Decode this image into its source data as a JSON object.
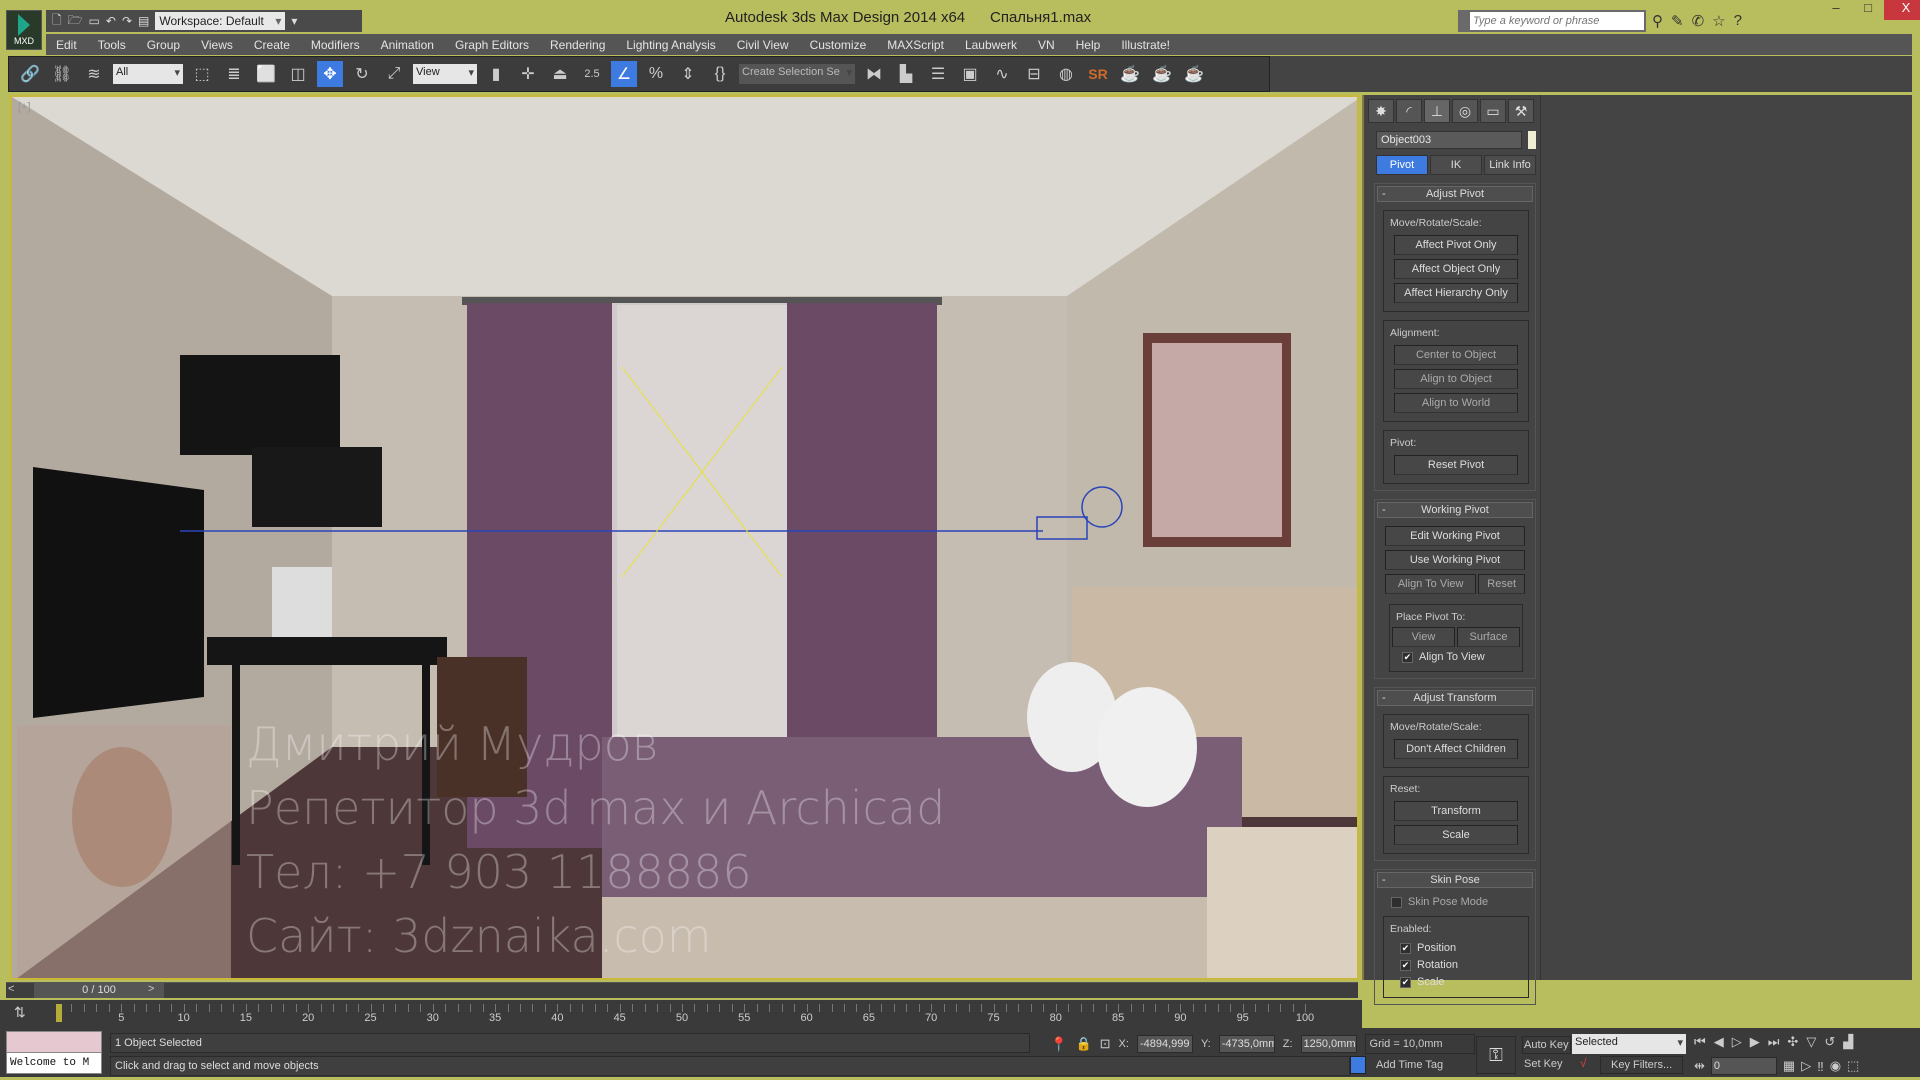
{
  "app": {
    "title": "Autodesk 3ds Max Design 2014 x64",
    "file": "Спальня1.max",
    "logo": "MXD",
    "workspace": "Workspace: Default",
    "accent": "#b8bd5e",
    "highlight": "#3d7be0"
  },
  "search": {
    "placeholder": "Type a keyword or phrase"
  },
  "menu": [
    "Edit",
    "Tools",
    "Group",
    "Views",
    "Create",
    "Modifiers",
    "Animation",
    "Graph Editors",
    "Rendering",
    "Lighting Analysis",
    "Civil View",
    "Customize",
    "MAXScript",
    "Laubwerk",
    "VN",
    "Help",
    "Illustrate!"
  ],
  "toolbar": {
    "filter": "All",
    "coord_system": "View",
    "snap_value": "2.5",
    "selection_set": "Create Selection Se",
    "render_label": "SR"
  },
  "watermark": [
    "Дмитрий Мудров",
    "Репетитор 3d max и Archicad",
    "Тел: +7 903 1188886",
    "Сайт: 3dznaika.com"
  ],
  "panel": {
    "object_name": "Object003",
    "subtabs": [
      "Pivot",
      "IK",
      "Link Info"
    ],
    "adjust_pivot": {
      "title": "Adjust Pivot",
      "mrs_label": "Move/Rotate/Scale:",
      "buttons": [
        "Affect Pivot Only",
        "Affect Object Only",
        "Affect Hierarchy Only"
      ],
      "alignment_label": "Alignment:",
      "align_buttons": [
        "Center to Object",
        "Align to Object",
        "Align to World"
      ],
      "pivot_label": "Pivot:",
      "reset": "Reset Pivot"
    },
    "working_pivot": {
      "title": "Working Pivot",
      "edit": "Edit Working Pivot",
      "use": "Use Working Pivot",
      "align_view": "Align To View",
      "reset": "Reset",
      "place_label": "Place Pivot To:",
      "view": "View",
      "surface": "Surface",
      "align_check": "Align To View",
      "align_checked": true
    },
    "adjust_transform": {
      "title": "Adjust Transform",
      "mrs_label": "Move/Rotate/Scale:",
      "dont_affect": "Don't Affect Children",
      "reset_label": "Reset:",
      "transform": "Transform",
      "scale": "Scale"
    },
    "skin_pose": {
      "title": "Skin Pose",
      "mode": "Skin Pose Mode",
      "mode_checked": false,
      "enabled_label": "Enabled:",
      "position": "Position",
      "rotation": "Rotation",
      "scale": "Scale",
      "position_checked": true,
      "rotation_checked": true,
      "scale_checked": true
    }
  },
  "timeline": {
    "frame": "0 / 100",
    "ticks": [
      "0",
      "5",
      "10",
      "15",
      "20",
      "25",
      "30",
      "35",
      "40",
      "45",
      "50",
      "55",
      "60",
      "65",
      "70",
      "75",
      "80",
      "85",
      "90",
      "95",
      "100"
    ]
  },
  "status": {
    "listener": "Welcome to M",
    "selection": "1 Object Selected",
    "prompt": "Click and drag to select and move objects",
    "x_label": "X:",
    "x": "-4894,999",
    "y_label": "Y:",
    "y": "-4735,0mm",
    "z_label": "Z:",
    "z": "1250,0mm",
    "grid": "Grid = 10,0mm",
    "add_time_tag": "Add Time Tag",
    "auto_key": "Auto Key",
    "set_key": "Set Key",
    "key_mode": "Selected",
    "key_filters": "Key Filters...",
    "current_frame": "0"
  }
}
